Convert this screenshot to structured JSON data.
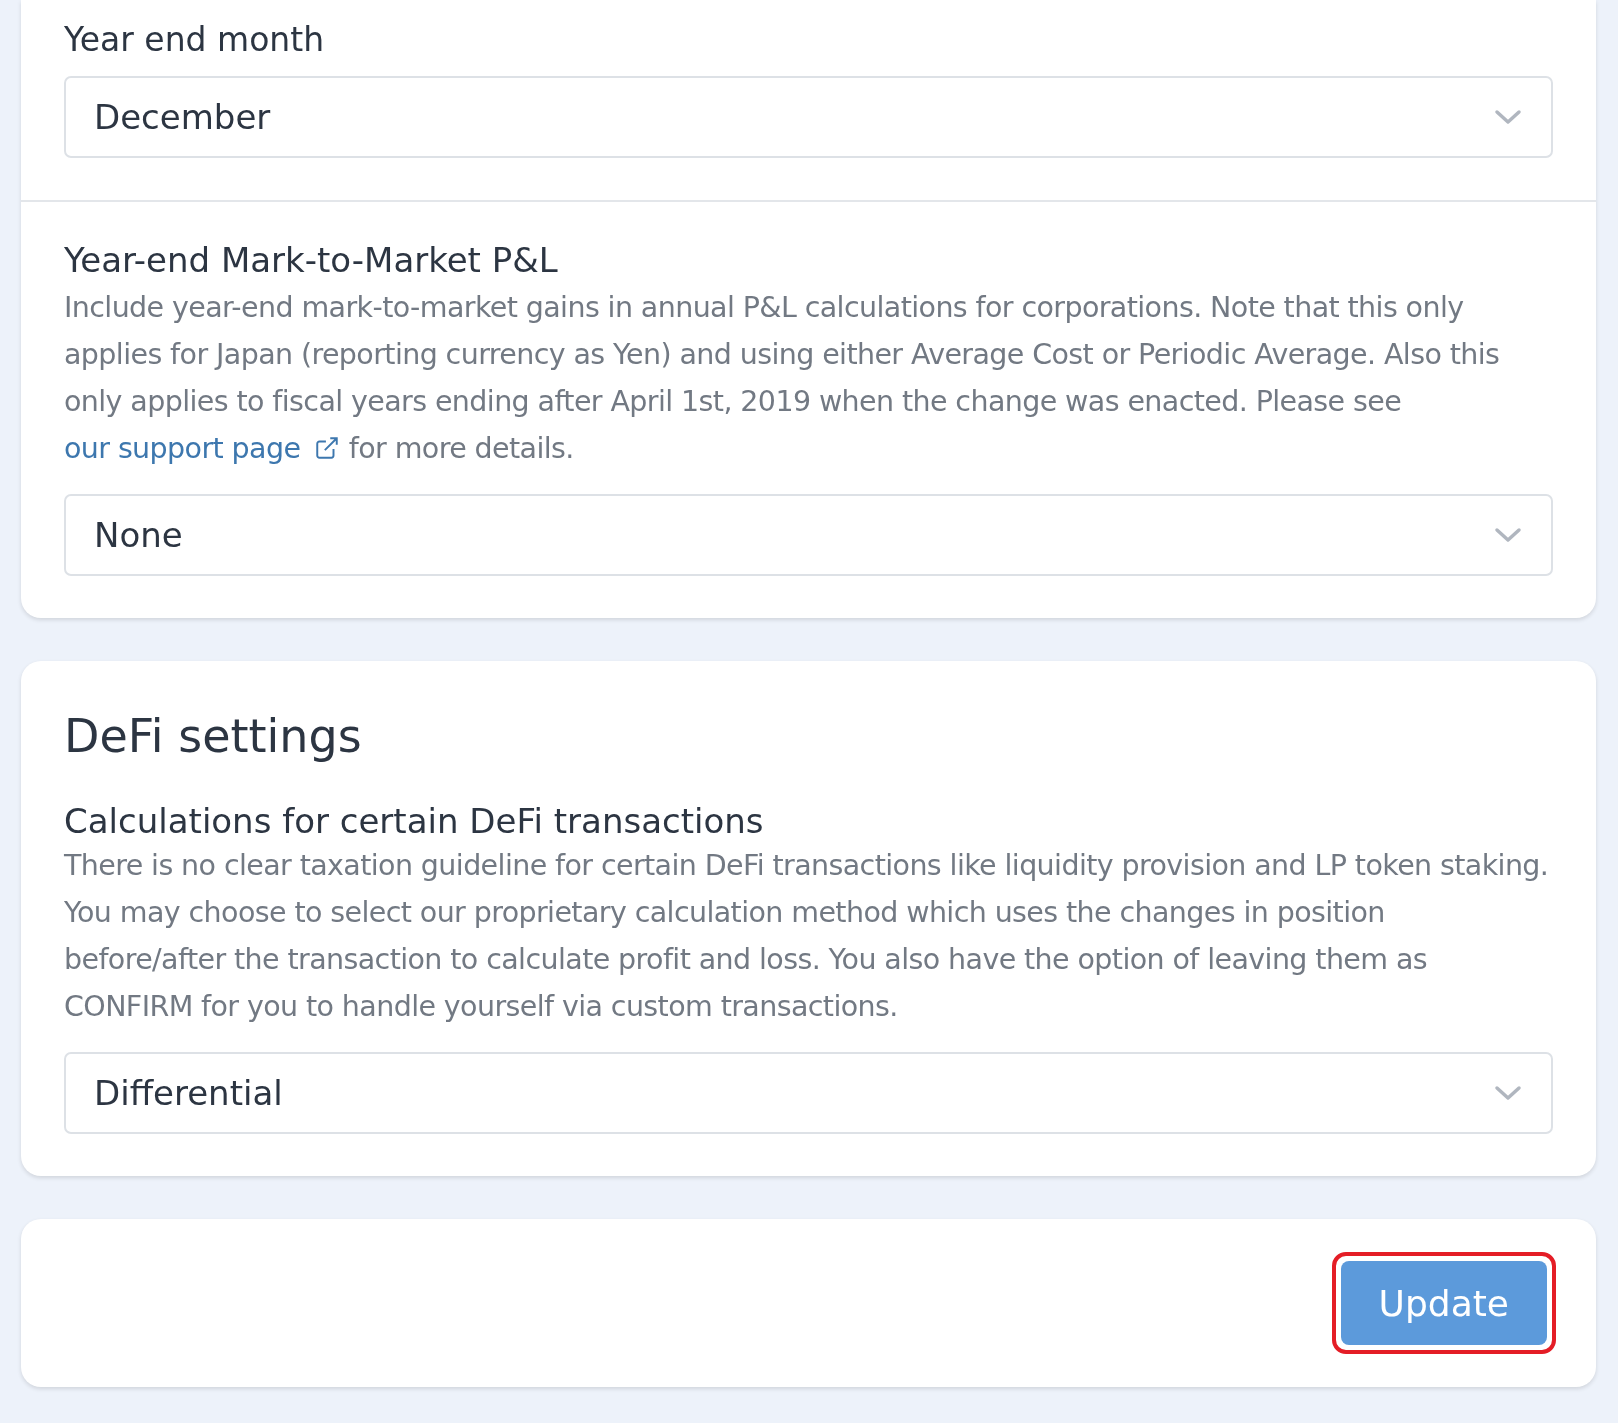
{
  "tax_card": {
    "sections": [
      {
        "title": "Year end month",
        "kind": "label",
        "select": {
          "value": "December"
        }
      },
      {
        "title": "Year-end Mark-to-Market P&L",
        "kind": "heading",
        "description": {
          "before": "Include year-end mark-to-market gains in annual P&L calculations for corporations. Note that this only applies for Japan (reporting currency as Yen) and using either Average Cost or Periodic Average. Also this only applies to fiscal years ending after April 1st, 2019 when the change was enacted. Please see",
          "link": "our support page",
          "after": "for more details."
        },
        "select": {
          "value": "None"
        }
      }
    ]
  },
  "defi_card": {
    "title": "DeFi settings",
    "sections": [
      {
        "title": "Calculations for certain DeFi transactions",
        "kind": "heading",
        "description": {
          "before": "There is no clear taxation guideline for certain DeFi transactions like liquidity provision and LP token staking. You may choose to select our proprietary calculation method which uses the changes in position before/after the transaction to calculate profit and loss. You also have the option of leaving them as CONFIRM for you to handle yourself via custom transactions."
        },
        "select": {
          "value": "Differential"
        }
      }
    ]
  },
  "footer": {
    "button": {
      "label": "Update",
      "highlighted": true
    }
  }
}
